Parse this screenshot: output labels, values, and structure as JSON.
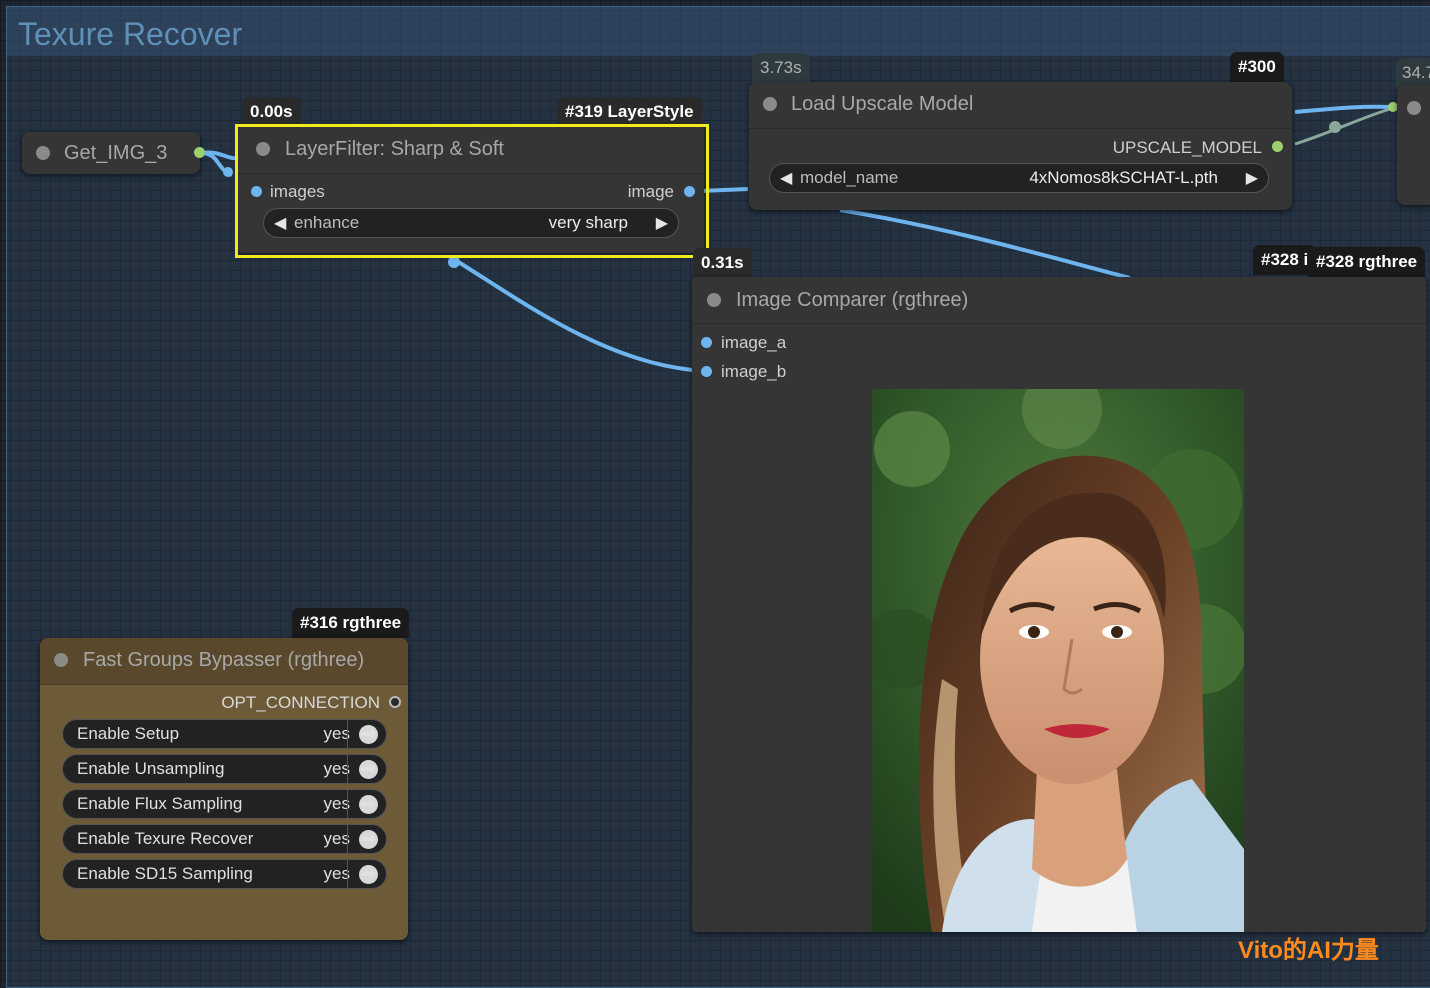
{
  "canvas": {
    "group_title": "Texure Recover"
  },
  "badges": {
    "get_img_time": "0.00s",
    "layerfilter_id": "#319 LayerStyle",
    "upscale_time": "3.73s",
    "upscale_id": "#300",
    "edge_time": "34.7",
    "comparer_time": "0.31s",
    "comparer_id_back": "#328 i",
    "comparer_id": "#328 rgthree",
    "bypasser_id": "#316 rgthree"
  },
  "get_img": {
    "title": "Get_IMG_3"
  },
  "layer_filter": {
    "title": "LayerFilter: Sharp & Soft",
    "input_label": "images",
    "output_label": "image",
    "widget": {
      "name": "enhance",
      "value": "very sharp"
    }
  },
  "upscale": {
    "title": "Load Upscale Model",
    "output_label": "UPSCALE_MODEL",
    "widget": {
      "name": "model_name",
      "value": "4xNomos8kSCHAT-L.pth"
    }
  },
  "comparer": {
    "title": "Image Comparer (rgthree)",
    "inputs": [
      "image_a",
      "image_b"
    ]
  },
  "bypasser": {
    "title": "Fast Groups Bypasser (rgthree)",
    "output_label": "OPT_CONNECTION",
    "rows": [
      {
        "label": "Enable Setup",
        "value": "yes"
      },
      {
        "label": "Enable Unsampling",
        "value": "yes"
      },
      {
        "label": "Enable Flux Sampling",
        "value": "yes"
      },
      {
        "label": "Enable Texure Recover",
        "value": "yes"
      },
      {
        "label": "Enable SD15 Sampling",
        "value": "yes"
      }
    ]
  },
  "watermark": "Vito的AI力量",
  "colors": {
    "wire_image": "#6eb5f0",
    "highlight": "#f2ea1a",
    "bypasser_bg": "#6d5a36",
    "watermark": "#ff8a1e"
  }
}
